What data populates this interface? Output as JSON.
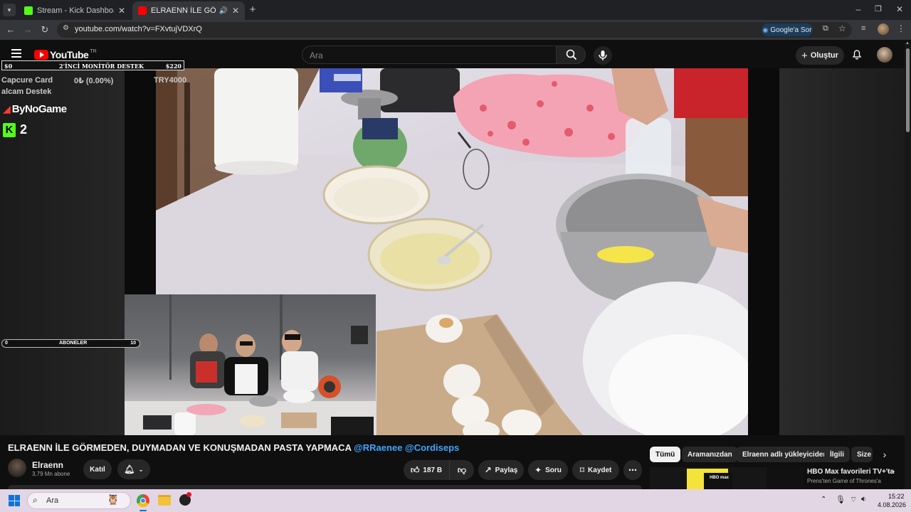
{
  "browser": {
    "tabs": [
      {
        "title": "Stream - Kick Dashboard",
        "active": false
      },
      {
        "title": "ELRAENN İLE GÖRMEDEN, D",
        "active": true
      }
    ],
    "url": "youtube.com/watch?v=FXvtujVDXrQ",
    "google_ask": "Google'a Sor"
  },
  "youtube": {
    "logo_text": "YouTube",
    "region": "TR",
    "search_placeholder": "Ara",
    "create_label": "Oluştur"
  },
  "overlay": {
    "donation_left": "$0",
    "donation_title": "2'İNCİ MONİTÖR DESTEK",
    "donation_right": "$220",
    "capcure_label": "Capcure Card",
    "capcure_progress": "0₺ (0.00%)",
    "capcure_goal": "TRY4000",
    "alcam_text": "alcam Destek",
    "bynogame": "ByNoGame",
    "kick_count": "2",
    "sub_left": "0",
    "sub_label": "ABONELER",
    "sub_right": "10"
  },
  "video": {
    "title_main": "ELRAENN İLE GÖRMEDEN, DUYMADAN VE KONUŞMADAN PASTA YAPMACA",
    "title_tags": "@RRaenee @Cordiseps",
    "channel_name": "Elraenn",
    "subscribers": "3,79 Mn abone",
    "join_label": "Katıl",
    "likes": "187 B",
    "share_label": "Paylaş",
    "ask_label": "Soru",
    "save_label": "Kaydet"
  },
  "chips": [
    "Tümü",
    "Aramanızdan",
    "Elraenn adlı yükleyiciden",
    "İlgili",
    "Size"
  ],
  "recommendation": {
    "title": "HBO Max favorileri TV+'ta",
    "subtitle": "Prens'ten Game of Thrones'a",
    "thumb_text": "HBO max"
  },
  "taskbar": {
    "search_placeholder": "Ara",
    "time": "15:22",
    "date": "4.08.2026"
  },
  "colors": {
    "youtube_red": "#ff0000",
    "link_blue": "#3ea6ff",
    "kick_green": "#53fc18"
  }
}
